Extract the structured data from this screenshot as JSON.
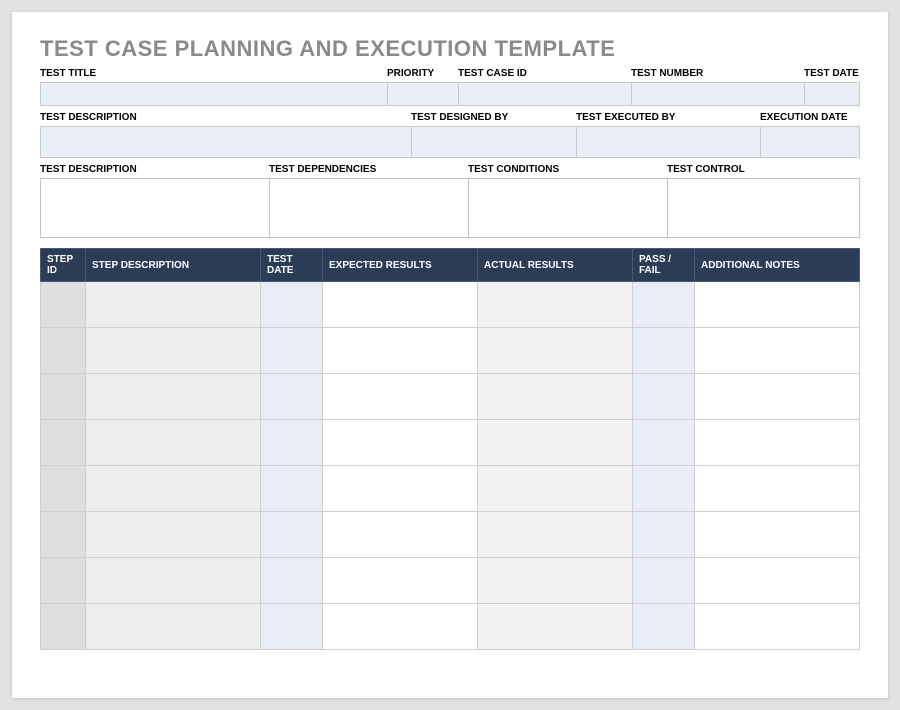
{
  "title": "TEST CASE PLANNING AND EXECUTION TEMPLATE",
  "row1": {
    "test_title": {
      "label": "TEST TITLE",
      "value": ""
    },
    "priority": {
      "label": "PRIORITY",
      "value": ""
    },
    "case_id": {
      "label": "TEST CASE ID",
      "value": ""
    },
    "number": {
      "label": "TEST NUMBER",
      "value": ""
    },
    "date": {
      "label": "TEST DATE",
      "value": ""
    }
  },
  "row2": {
    "description": {
      "label": "TEST DESCRIPTION",
      "value": ""
    },
    "designed_by": {
      "label": "TEST DESIGNED BY",
      "value": ""
    },
    "executed_by": {
      "label": "TEST EXECUTED BY",
      "value": ""
    },
    "exec_date": {
      "label": "EXECUTION DATE",
      "value": ""
    }
  },
  "row3": {
    "description": {
      "label": "TEST DESCRIPTION",
      "value": ""
    },
    "dependencies": {
      "label": "TEST DEPENDENCIES",
      "value": ""
    },
    "conditions": {
      "label": "TEST CONDITIONS",
      "value": ""
    },
    "control": {
      "label": "TEST CONTROL",
      "value": ""
    }
  },
  "steps": {
    "headers": {
      "step_id": "STEP ID",
      "step_desc": "STEP DESCRIPTION",
      "test_date": "TEST DATE",
      "expected": "EXPECTED RESULTS",
      "actual": "ACTUAL RESULTS",
      "passfail": "PASS / FAIL",
      "notes": "ADDITIONAL NOTES"
    },
    "rows": 8
  }
}
